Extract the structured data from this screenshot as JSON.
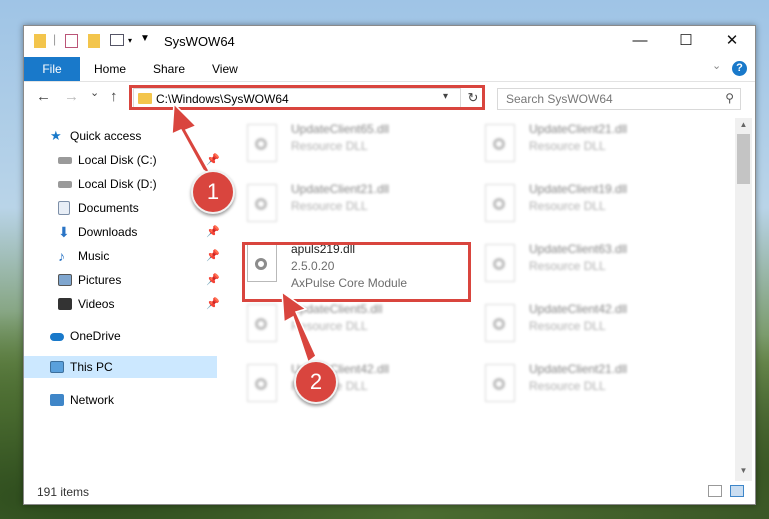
{
  "window": {
    "title": "SysWOW64"
  },
  "ribbon": {
    "tabs": [
      "File",
      "Home",
      "Share",
      "View"
    ],
    "help_label": "?"
  },
  "navigation": {
    "back": "←",
    "forward": "→",
    "recent": "⌄",
    "up": "↑",
    "refresh": "↻"
  },
  "address": {
    "path": "C:\\Windows\\SysWOW64"
  },
  "search": {
    "placeholder": "Search SysWOW64"
  },
  "sidebar": {
    "items": [
      {
        "label": "Quick access",
        "icon": "star-icon",
        "pinned": false
      },
      {
        "label": "Local Disk (C:)",
        "icon": "drive-icon",
        "pinned": true
      },
      {
        "label": "Local Disk (D:)",
        "icon": "drive-icon",
        "pinned": false
      },
      {
        "label": "Documents",
        "icon": "document-icon",
        "pinned": true
      },
      {
        "label": "Downloads",
        "icon": "download-icon",
        "pinned": true
      },
      {
        "label": "Music",
        "icon": "music-icon",
        "pinned": true
      },
      {
        "label": "Pictures",
        "icon": "picture-icon",
        "pinned": true
      },
      {
        "label": "Videos",
        "icon": "video-icon",
        "pinned": true
      },
      {
        "label": "OneDrive",
        "icon": "cloud-icon",
        "pinned": false
      },
      {
        "label": "This PC",
        "icon": "computer-icon",
        "pinned": false
      },
      {
        "label": "Network",
        "icon": "network-icon",
        "pinned": false
      }
    ]
  },
  "files": {
    "left": [
      {
        "name": "UpdateClient65.dll",
        "line2": "Resource DLL",
        "line3": ""
      },
      {
        "name": "UpdateClient21.dll",
        "line2": "Resource DLL",
        "line3": ""
      },
      {
        "name": "apuls219.dll",
        "line2": "2.5.0.20",
        "line3": "AxPulse Core Module"
      },
      {
        "name": "UpdateClient5.dll",
        "line2": "Resource DLL",
        "line3": ""
      },
      {
        "name": "UpdateClient42.dll",
        "line2": "Resource DLL",
        "line3": ""
      }
    ],
    "right": [
      {
        "name": "UpdateClient21.dll",
        "line2": "Resource DLL"
      },
      {
        "name": "UpdateClient19.dll",
        "line2": "Resource DLL"
      },
      {
        "name": "UpdateClient63.dll",
        "line2": "Resource DLL"
      },
      {
        "name": "UpdateClient42.dll",
        "line2": "Resource DLL"
      },
      {
        "name": "UpdateClient21.dll",
        "line2": "Resource DLL"
      }
    ]
  },
  "status": {
    "items_count": "191 items"
  },
  "annotations": {
    "step1": "1",
    "step2": "2",
    "highlight_color": "#d9453e"
  },
  "colors": {
    "accent": "#1979ca",
    "selection": "#cce8ff"
  }
}
